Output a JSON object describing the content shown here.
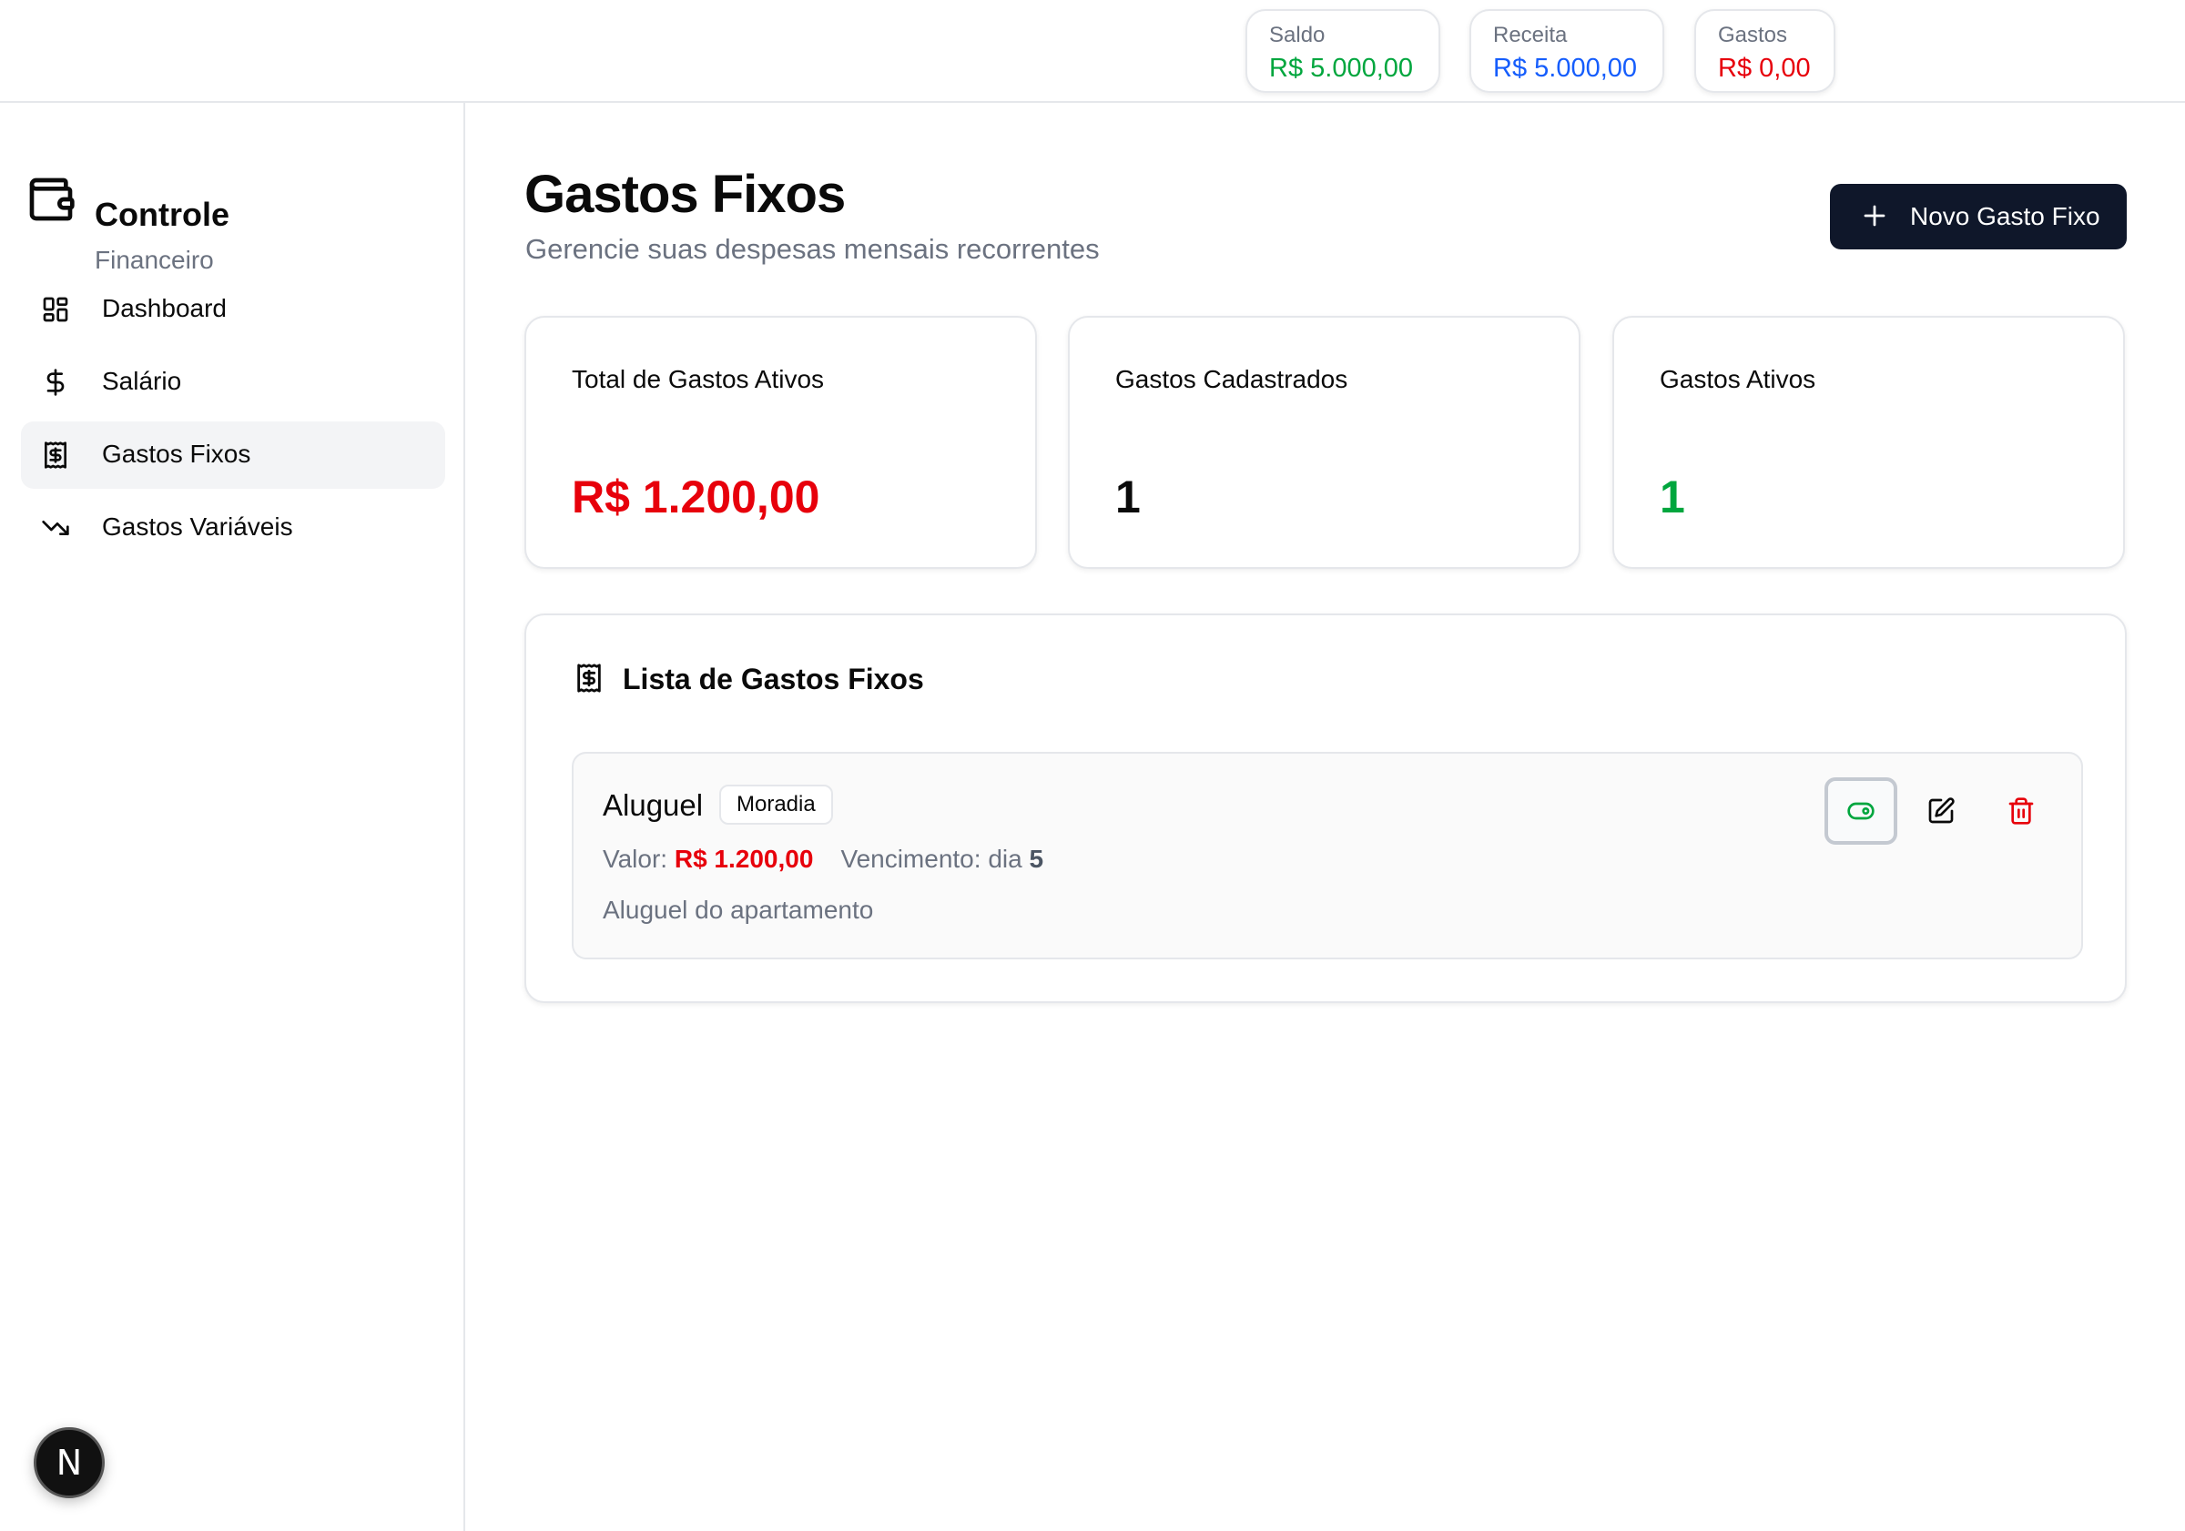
{
  "topbar": {
    "saldo": {
      "label": "Saldo",
      "value": "R$ 5.000,00",
      "color": "#00a63e"
    },
    "receita": {
      "label": "Receita",
      "value": "R$ 5.000,00",
      "color": "#155dfc"
    },
    "gastos": {
      "label": "Gastos",
      "value": "R$ 0,00",
      "color": "#e7000b"
    }
  },
  "sidebar": {
    "brand_title": "Controle",
    "brand_subtitle": "Financeiro",
    "brand_icon": "wallet-icon",
    "items": [
      {
        "label": "Dashboard",
        "icon": "dashboard-grid-icon",
        "active": false
      },
      {
        "label": "Salário",
        "icon": "dollar-sign-icon",
        "active": false
      },
      {
        "label": "Gastos Fixos",
        "icon": "receipt-icon",
        "active": true
      },
      {
        "label": "Gastos Variáveis",
        "icon": "trending-down-icon",
        "active": false
      }
    ],
    "badge_letter": "N"
  },
  "main": {
    "title": "Gastos Fixos",
    "subtitle": "Gerencie suas despesas mensais recorrentes",
    "new_button_label": "Novo Gasto Fixo",
    "cards": [
      {
        "title": "Total de Gastos Ativos",
        "value": "R$ 1.200,00",
        "color": "#e7000b"
      },
      {
        "title": "Gastos Cadastrados",
        "value": "1",
        "color": "#0a0a0a"
      },
      {
        "title": "Gastos Ativos",
        "value": "1",
        "color": "#00a63e"
      }
    ],
    "list": {
      "title": "Lista de Gastos Fixos",
      "items": [
        {
          "name": "Aluguel",
          "category": "Moradia",
          "valor_label": "Valor:",
          "valor": "R$ 1.200,00",
          "vencimento_label": "Vencimento: dia",
          "vencimento_dia": "5",
          "description": "Aluguel do apartamento"
        }
      ]
    }
  },
  "colors": {
    "primary_button": "#0f172a",
    "danger": "#e7000b",
    "success": "#00a63e",
    "info": "#155dfc"
  }
}
